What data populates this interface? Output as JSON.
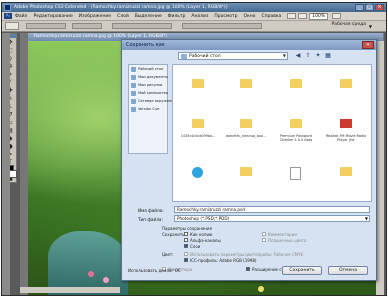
{
  "app": {
    "title": "Adobe Photoshop CS3 Extended - [Ramochky.ramizruzzi ramna.jpg @ 100% (Layer 1, RGB/8*)]",
    "menu": [
      "Файл",
      "Редактирование",
      "Изображение",
      "Слой",
      "Выделение",
      "Фильтр",
      "Анализ",
      "Просмотр",
      "Окно",
      "Справка"
    ],
    "zoom": "100%",
    "workspace_label": "Рабочая среда"
  },
  "document": {
    "title": "Ramochky.ramizruzzi ramna.jpg @ 100% (Layer 1, RGB/8*)"
  },
  "dialog": {
    "title": "Сохранить как",
    "folder": "Рабочий стол",
    "places": [
      {
        "label": "Рабочий стол",
        "icon": "desktop-icon"
      },
      {
        "label": "Мои документы",
        "icon": "documents-icon"
      },
      {
        "label": "Мои рисунки",
        "icon": "pictures-icon"
      },
      {
        "label": "Мой компьютер",
        "icon": "computer-icon"
      },
      {
        "label": "Сетевое окружение",
        "icon": "network-icon"
      },
      {
        "label": "Version Cue",
        "icon": "version-cue-icon"
      }
    ],
    "files": [
      {
        "name": "",
        "icon": "folder-icon",
        "kind": "folder"
      },
      {
        "name": "",
        "icon": "folder-icon",
        "kind": "folder"
      },
      {
        "name": "",
        "icon": "folder-icon",
        "kind": "folder"
      },
      {
        "name": "",
        "icon": "folder-icon",
        "kind": "folder"
      },
      {
        "name": "1435c4c0cd099ba...",
        "icon": "folder-icon",
        "kind": "folder"
      },
      {
        "name": "dotnetfx_cleanup_tool...",
        "icon": "folder-icon",
        "kind": "folder"
      },
      {
        "name": "Premium Password Checker 1.0.0 Beta",
        "icon": "folder-icon",
        "kind": "folder"
      },
      {
        "name": "Realtek FM Movie Radio Player (for",
        "icon": "radio-icon",
        "kind": "red"
      },
      {
        "name": "",
        "icon": "skype-icon",
        "kind": "skype"
      },
      {
        "name": "",
        "icon": "folder-icon",
        "kind": "folder"
      },
      {
        "name": "",
        "icon": "document-icon",
        "kind": "doc"
      },
      {
        "name": "",
        "icon": "folder-icon",
        "kind": "folder"
      }
    ],
    "filename_label": "Имя файла:",
    "filename_value": "Ramochky.ramizruzzi ramna.psd",
    "filetype_label": "Тип файла:",
    "filetype_value": "Photoshop (*.PSD;*.PDD)",
    "options_title": "Параметры сохранения",
    "save_label": "Сохранить:",
    "as_copy": "Как копию",
    "alpha": "Альфа-каналы",
    "layers": "Слои",
    "annotations": "Комментарии",
    "spot_colors": "Плашечные цвета",
    "color_label": "Цвет:",
    "use_proof": "Использовать параметры цветопробы: Рабочее CMYK",
    "icc_profile": "ICC-профиль: Adobe RGB (1998)",
    "thumbnail": "Миниатюра",
    "ext_lower": "Расширение строчными буквами",
    "adobe_dialog": "Использовать диалог ОС",
    "save_button": "Сохранить",
    "cancel_button": "Отмена"
  }
}
